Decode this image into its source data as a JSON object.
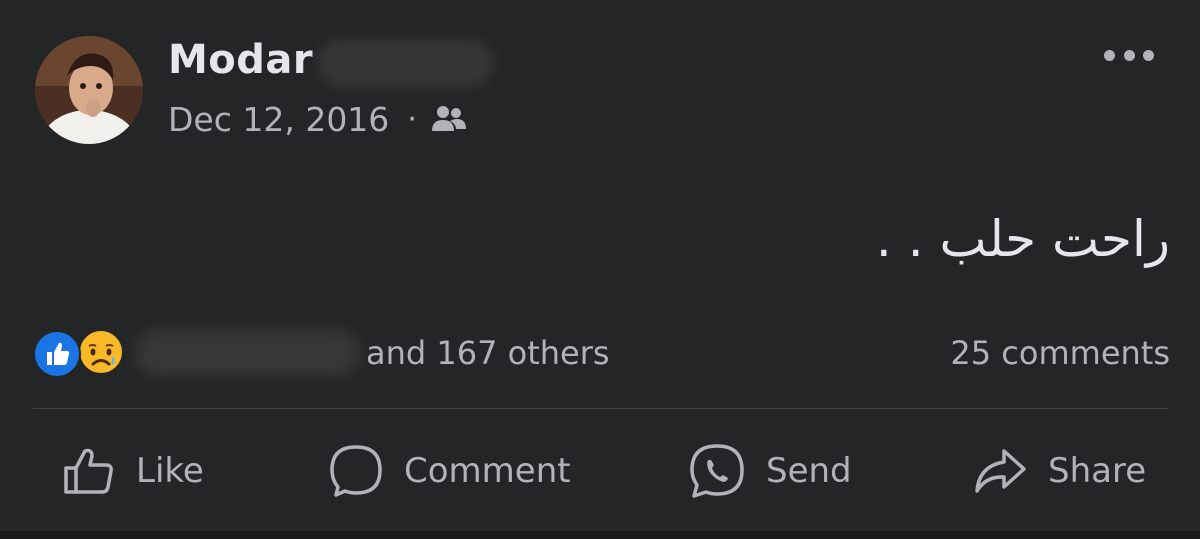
{
  "post": {
    "author": "Modar",
    "date": "Dec 12, 2016",
    "separator": "·",
    "audience_icon": "friends-icon",
    "text": "راحت حلب . .",
    "more_icon": "more-options-icon"
  },
  "reactions": {
    "types": [
      "like",
      "sad"
    ],
    "others_text": "and 167 others",
    "comments_text": "25 comments"
  },
  "actions": {
    "like": "Like",
    "comment": "Comment",
    "send": "Send",
    "share": "Share"
  },
  "colors": {
    "background": "#242526",
    "text_primary": "#e4e6eb",
    "text_secondary": "#b0b3b8",
    "like_blue": "#1b74e4",
    "sad_yellow": "#f7b928"
  }
}
